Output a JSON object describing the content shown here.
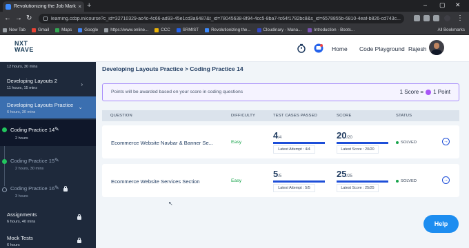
{
  "browser": {
    "tab_title": "Revolutionizing the Job Market |",
    "url": "learning.ccbp.in/course?c_id=32710329-ac4c-4c66-ad93-45e1cd3a6487&t_id=78045638-8f94-4cc5-8ba7-fc64f1782bc8&s_id=6578855b-6810-4eaf-b826-cd743c...",
    "bookmarks": [
      {
        "label": "New Tab",
        "color": "#9aa0a6"
      },
      {
        "label": "Gmail",
        "color": "#ea4335"
      },
      {
        "label": "Maps",
        "color": "#34a853"
      },
      {
        "label": "Google",
        "color": "#4285f4"
      },
      {
        "label": "https://www.online...",
        "color": "#9aa0a6"
      },
      {
        "label": "CCC",
        "color": "#eab308"
      },
      {
        "label": "SRMIST",
        "color": "#2563eb"
      },
      {
        "label": "Revolutionizing the...",
        "color": "#3d8bfd"
      },
      {
        "label": "Cloudinary - Mana...",
        "color": "#3448c5"
      },
      {
        "label": "Introduction · Boots...",
        "color": "#7952b3"
      }
    ],
    "all_bookmarks": "All Bookmarks"
  },
  "header": {
    "logo_top": "NXT",
    "logo_bottom": "WAVE",
    "home": "Home",
    "playground": "Code Playground",
    "user": "Rajesh"
  },
  "sidebar": {
    "top_sub": "12 hours, 30 mins",
    "items": [
      {
        "title": "Developing Layouts 2",
        "sub": "11 hours, 15 mins"
      },
      {
        "title": "Developing Layouts Practice",
        "sub": "6 hours, 30 mins"
      }
    ],
    "practices": [
      {
        "title": "Coding Practice 14",
        "sub": "2 hours"
      },
      {
        "title": "Coding Practice 15",
        "sub": "2 hours, 30 mins"
      },
      {
        "title": "Coding Practice 16",
        "sub": "3 hours"
      }
    ],
    "assignments": {
      "title": "Assignments",
      "sub": "6 hours, 40 mins"
    },
    "mock": {
      "title": "Mock Tests",
      "sub": "6 hours"
    }
  },
  "main": {
    "breadcrumb": "Developing Layouts Practice > Coding Practice 14",
    "notice": "Points will be awarded based on your score in coding questions",
    "score_rule_left": "1 Score =",
    "score_rule_right": "1 Point",
    "columns": [
      "QUESTION",
      "DIFFICULTY",
      "TEST CASES PASSED",
      "SCORE",
      "STATUS"
    ],
    "rows": [
      {
        "question": "Ecommerce Website Navbar & Banner Se...",
        "difficulty": "Easy",
        "passed": "4",
        "passed_total": "/4",
        "attempt": "Latest Attempt : 4/4",
        "score": "20",
        "score_total": "/20",
        "latest_score": "Latest Score : 20/20",
        "status": "SOLVED"
      },
      {
        "question": "Ecommerce Website Services Section",
        "difficulty": "Easy",
        "passed": "5",
        "passed_total": "/5",
        "attempt": "Latest Attempt : 5/5",
        "score": "25",
        "score_total": "/25",
        "latest_score": "Latest Score : 25/25",
        "status": "SOLVED"
      }
    ]
  },
  "help": "Help",
  "colors": {
    "accent": "#1d4ed8",
    "sidebar": "#1e293b",
    "active": "#3b6fb0",
    "success": "#16a34a"
  }
}
